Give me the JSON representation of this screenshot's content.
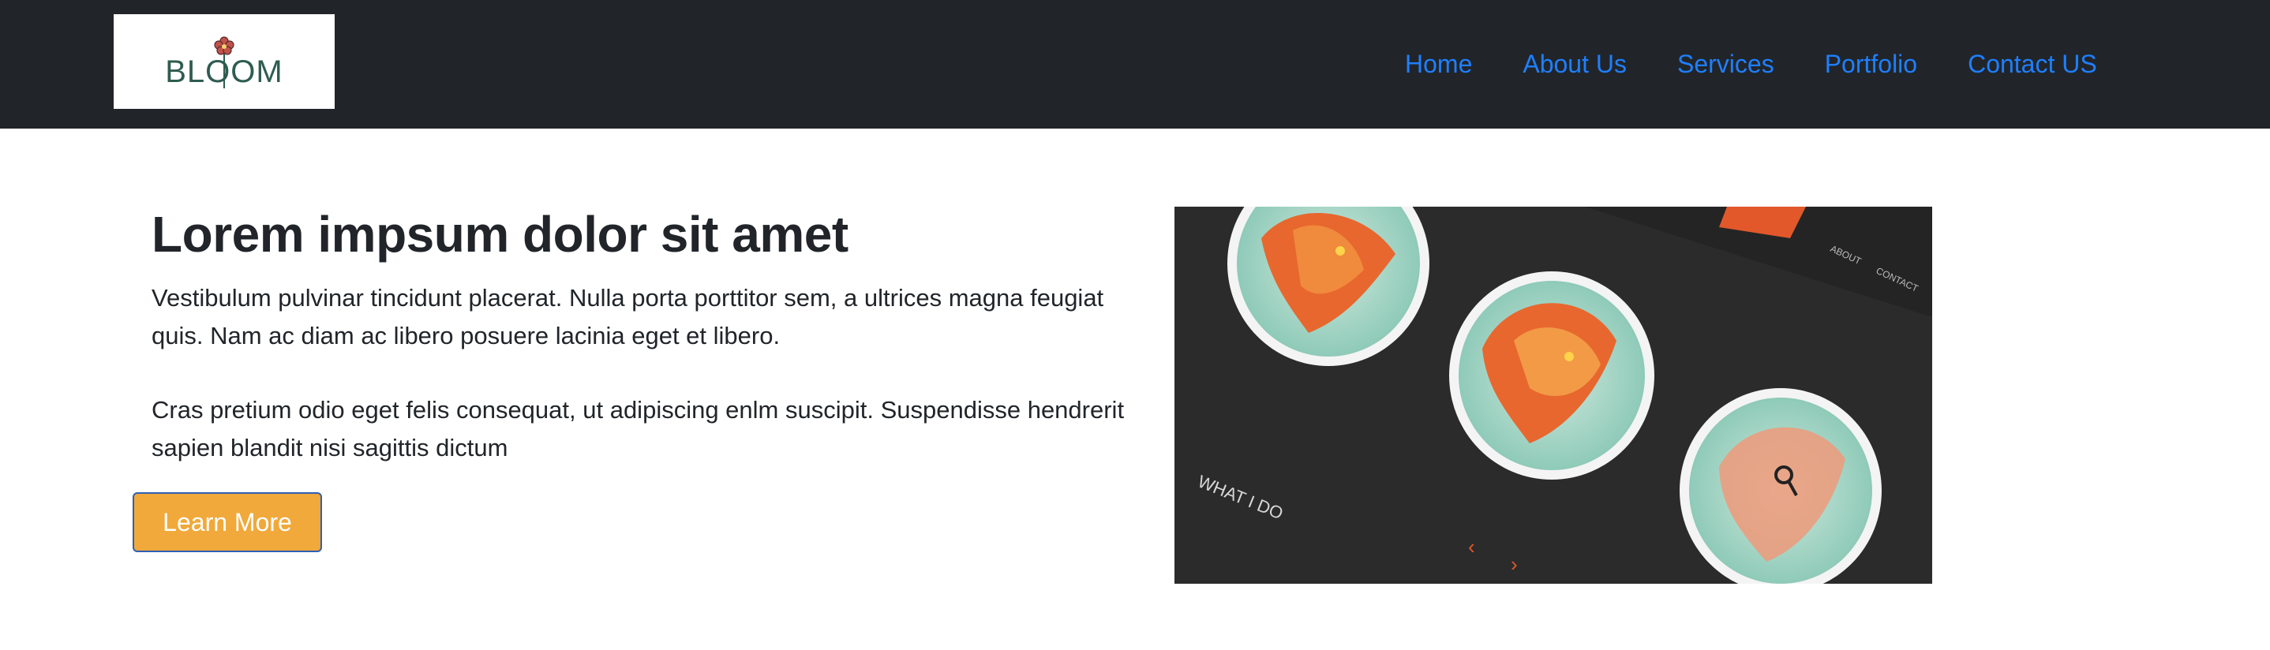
{
  "logo": {
    "text": "BLOOM",
    "icon": "flower-icon"
  },
  "nav": {
    "items": [
      {
        "label": "Home"
      },
      {
        "label": "About Us"
      },
      {
        "label": "Services"
      },
      {
        "label": "Portfolio"
      },
      {
        "label": "Contact US"
      }
    ]
  },
  "hero": {
    "title": "Lorem impsum dolor sit amet",
    "paragraph1": "Vestibulum pulvinar tincidunt placerat. Nulla porta porttitor sem, a ultrices magna feugiat quis. Nam ac diam ac libero posuere lacinia eget et libero.",
    "paragraph2": "Cras pretium odio eget felis consequat, ut adipiscing enlm suscipit. Suspendisse hendrerit sapien blandit nisi sagittis dictum",
    "button_label": "Learn More"
  },
  "image": {
    "caption": "WHAT I DO",
    "corner_labels": [
      "ABOUT",
      "CONTACT"
    ],
    "subject": "dragon-illustration-plates"
  },
  "colors": {
    "navbar_bg": "#212529",
    "link": "#1f7fff",
    "button_bg": "#f0a93a",
    "button_border": "#2f5fb3",
    "logo_green": "#2e5c50"
  }
}
